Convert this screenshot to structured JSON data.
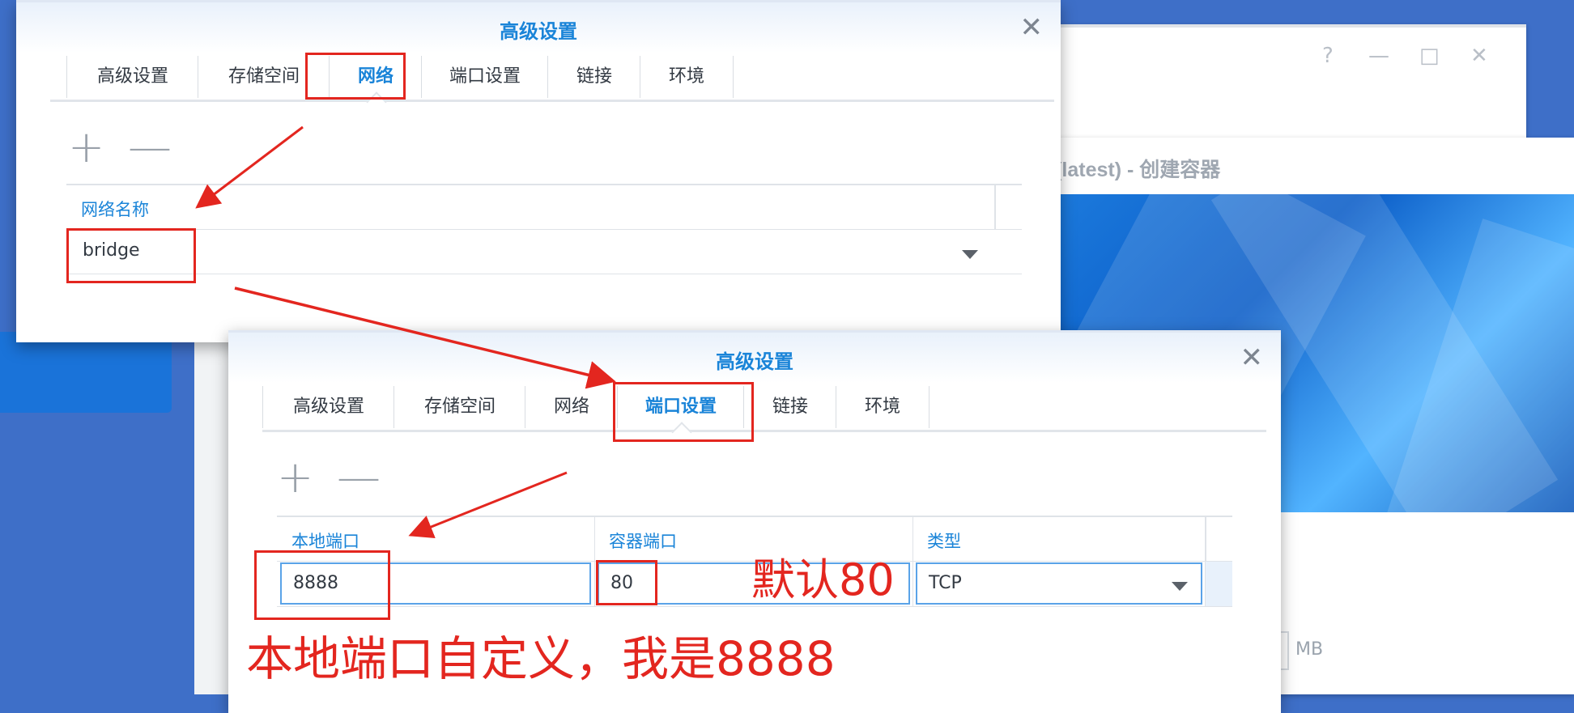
{
  "background": {
    "window_controls": [
      "?",
      "—",
      "□",
      "✕"
    ],
    "window_title": "shy(latest) - 创建容器",
    "unit_label": "MB"
  },
  "dialog_network": {
    "title": "高级设置",
    "tabs": [
      "高级设置",
      "存储空间",
      "网络",
      "端口设置",
      "链接",
      "环境"
    ],
    "active_tab": "网络",
    "toolbar": {
      "add": "+",
      "remove": "—"
    },
    "column_header": "网络名称",
    "network_value": "bridge"
  },
  "dialog_ports": {
    "title": "高级设置",
    "tabs": [
      "高级设置",
      "存储空间",
      "网络",
      "端口设置",
      "链接",
      "环境"
    ],
    "active_tab": "端口设置",
    "toolbar": {
      "add": "+",
      "remove": "—"
    },
    "columns": [
      "本地端口",
      "容器端口",
      "类型"
    ],
    "row": {
      "local_port": "8888",
      "container_port": "80",
      "type": "TCP"
    }
  },
  "annotations": {
    "default_note": "默认80",
    "local_note": "本地端口自定义，我是8888"
  },
  "colors": {
    "accent": "#1a84d8",
    "annotation": "#e3261f",
    "desktop": "#3e6fc8"
  }
}
